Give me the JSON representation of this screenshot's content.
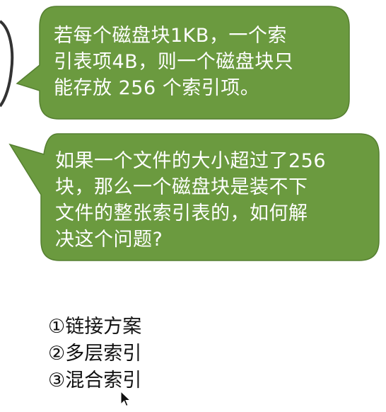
{
  "bubbles": [
    {
      "lines": [
        "若每个磁盘块1KB，一个索",
        "引表项4B，则一个磁盘块只",
        "能存放 256 个索引项。"
      ]
    },
    {
      "lines": [
        "如果一个文件的大小超过了256",
        "块，那么一个磁盘块是装不下",
        "文件的整张索引表的，如何解",
        "决这个问题?"
      ]
    }
  ],
  "options": [
    "①链接方案",
    "②多层索引",
    "③混合索引"
  ],
  "colors": {
    "bubble_fill": "#6b9a3f",
    "bubble_stroke": "#557f30",
    "bubble_text": "#ffffff",
    "option_text": "#111111",
    "background": "#ffffff"
  },
  "icons": {
    "cursor": "mouse-pointer-icon"
  }
}
